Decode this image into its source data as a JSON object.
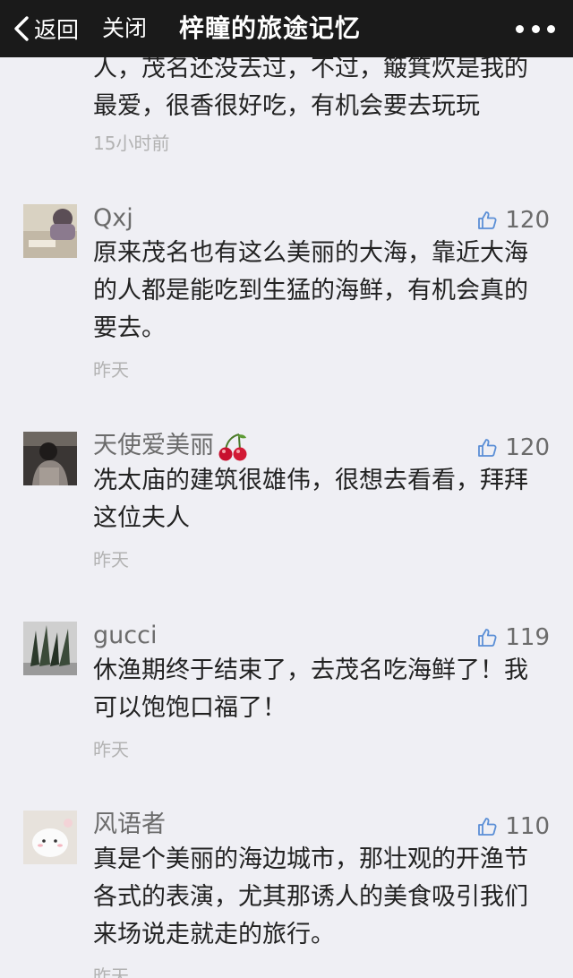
{
  "navbar": {
    "back_label": "返回",
    "close_label": "关闭",
    "title": "梓瞳的旅途记忆"
  },
  "comments": [
    {
      "text": "人，茂名还没去过，不过，簸箕炊是我的最爱，很香很好吃，有机会要去玩玩",
      "time": "15小时前"
    },
    {
      "name": "Qxj",
      "likes": "120",
      "text": "原来茂名也有这么美丽的大海，靠近大海的人都是能吃到生猛的海鲜，有机会真的要去。",
      "time": "昨天"
    },
    {
      "name": "天使爱美丽",
      "name_emoji": "cherry-icon",
      "likes": "120",
      "text": "冼太庙的建筑很雄伟，很想去看看，拜拜这位夫人",
      "time": "昨天"
    },
    {
      "name": "gucci",
      "likes": "119",
      "text": "休渔期终于结束了，去茂名吃海鲜了！我可以饱饱口福了！",
      "time": "昨天"
    },
    {
      "name": "风语者",
      "likes": "110",
      "text": "真是个美丽的海边城市，那壮观的开渔节各式的表演，尤其那诱人的美食吸引我们来场说走就走的旅行。",
      "time": "昨天"
    }
  ],
  "icons": {
    "back": "chevron-left-icon",
    "more": "more-dots-icon",
    "like": "thumbs-up-icon"
  },
  "colors": {
    "navbar_bg": "#1a1a1a",
    "page_bg": "#efeff4",
    "like_icon": "#5b8fd6",
    "muted_text": "#b2b2b2"
  }
}
